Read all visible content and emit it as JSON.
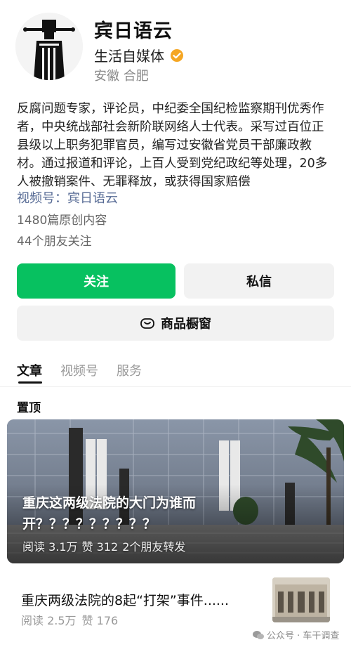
{
  "profile": {
    "name": "宾日语云",
    "category": "生活自媒体",
    "location": "安徽 合肥",
    "bio": "反腐问题专家，评论员，中纪委全国纪检监察期刊优秀作者，中央统战部社会新阶联网络人士代表。采写过百位正县级以上职务犯罪官员，编写过安徽省党员干部廉政教材。通过报道和评论，上百人受到党纪政纪等处理，20多人被撤销案件、无罪释放，或获得国家赔偿",
    "video_channel": "视频号：宾日语云",
    "original_count": "1480篇原创内容",
    "friends_following": "44个朋友关注"
  },
  "actions": {
    "follow": "关注",
    "message": "私信",
    "shop": "商品橱窗"
  },
  "tabs": [
    {
      "label": "文章",
      "active": true
    },
    {
      "label": "视频号",
      "active": false
    },
    {
      "label": "服务",
      "active": false
    }
  ],
  "pinned_label": "置顶",
  "pinned_article": {
    "title": "重庆这两级法院的大门为谁而开？？？？？？？？？",
    "reads": "阅读 3.1万",
    "likes": "赞 312",
    "shares": "2个朋友转发"
  },
  "article": {
    "title": "重庆两级法院的8起“打架”事件......",
    "reads": "阅读 2.5万",
    "likes": "赞 176"
  },
  "watermark": "公众号 · 车干调查",
  "colors": {
    "accent_green": "#07c160",
    "link_blue": "#576b95",
    "verified_gold": "#f5a623"
  }
}
